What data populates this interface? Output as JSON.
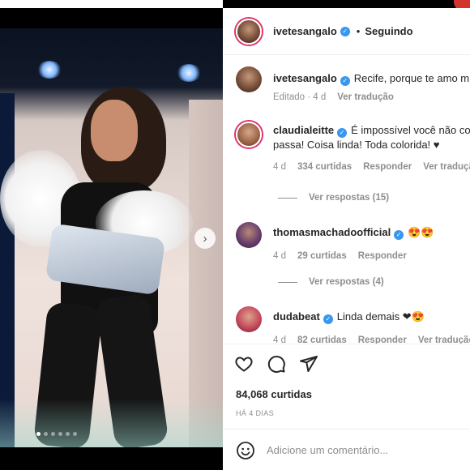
{
  "post": {
    "author": "ivetesangalo",
    "follow_status": "Seguindo",
    "separator": "•",
    "caption": "Recife, porque te amo m",
    "caption_meta": {
      "edited": "Editado · 4 d",
      "translate": "Ver tradução"
    },
    "likes": "84,068 curtidas",
    "timestamp": "HÁ 4 DIAS",
    "add_comment_placeholder": "Adicione um comentário...",
    "carousel": {
      "count": 6,
      "active_index": 0
    }
  },
  "comments": [
    {
      "username": "claudialeitte",
      "text_line1": "É impossível você não co",
      "text_line2": "passa! Coisa linda! Toda colorida! ♥",
      "age": "4 d",
      "likes": "334 curtidas",
      "reply": "Responder",
      "translate": "Ver traduçã",
      "replies": "Ver respostas (15)"
    },
    {
      "username": "thomasmachadoofficial",
      "text_line1": "😍😍",
      "age": "4 d",
      "likes": "29 curtidas",
      "reply": "Responder",
      "replies": "Ver respostas (4)"
    },
    {
      "username": "dudabeat",
      "text_line1": "Linda demais ❤😍",
      "age": "4 d",
      "likes": "82 curtidas",
      "reply": "Responder",
      "translate": "Ver tradução"
    }
  ],
  "icons": {
    "like": "heart-icon",
    "comment": "comment-icon",
    "share": "paper-plane-icon",
    "emoji": "smiley-icon",
    "next": "chevron-right-icon",
    "verified": "verified-badge-icon"
  },
  "colors": {
    "verified": "#3897f0",
    "link_gray": "#8e8e8e",
    "story_ring": "#e1306c"
  }
}
